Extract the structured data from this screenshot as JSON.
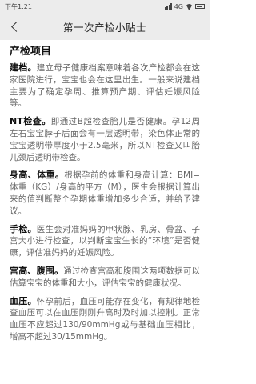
{
  "status": {
    "time": "下午1:21",
    "network": "4G"
  },
  "header": {
    "title": "第一次产检小贴士"
  },
  "content": {
    "section_title": "产检项目",
    "items": [
      {
        "term": "建档。",
        "text": "建立母子健康档案意味着各次产检都会在这家医院进行，宝宝也会在这里出生。一般来说建档主要为了确定孕周、推算预产期、评估妊娠风险等。"
      },
      {
        "term": "NT检查。",
        "text": "即通过B超检查胎儿是否健康。孕12周左右宝宝脖子后面会有一层透明带，染色体正常的宝宝透明带厚度小于2.5毫米，所以NT检查又叫胎儿颈后透明带检查。"
      },
      {
        "term": "身高、体重。",
        "text": "根据孕前的体重和身高计算：BMI=体重（KG）/身高的平方（M），医生会根据计算出来的值判断整个孕期体重增加多少合适，并给予建议。"
      },
      {
        "term": "手检。",
        "text": "医生会对准妈妈的甲状腺、乳房、骨盆、子宫大小进行检查，以判断宝宝生长的“环境”是否健康，评估准妈妈的妊娠风险。"
      },
      {
        "term": "宫高、腹围。",
        "text": "通过检查宫高和腹围这两项数据可以估算宝宝的体重和大小，评估宝宝的健康状况。"
      },
      {
        "term": "血压。",
        "text": "怀孕前后，血压可能存在变化，有规律地检查血压可以在血压刚刚升高时及时加以控制。正常血压不应超过130/90mmHg或与基础血压相比，增高不超过30/15mmHg。"
      }
    ]
  }
}
